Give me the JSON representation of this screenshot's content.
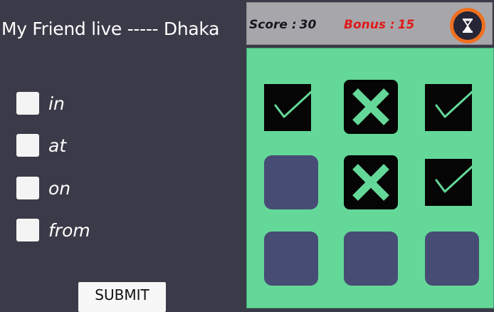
{
  "question": {
    "text": "My Friend live ----- Dhaka"
  },
  "options": [
    {
      "label": "in",
      "checked": false
    },
    {
      "label": "at",
      "checked": false
    },
    {
      "label": "on",
      "checked": false
    },
    {
      "label": "from",
      "checked": false
    }
  ],
  "submit": {
    "label": "SUBMIT"
  },
  "score": {
    "label": "Score :",
    "value": "30"
  },
  "bonus": {
    "label": "Bonus :",
    "value": "15"
  },
  "timer": {
    "icon": "hourglass-icon"
  },
  "board": {
    "cells": [
      {
        "state": "check"
      },
      {
        "state": "cross"
      },
      {
        "state": "check"
      },
      {
        "state": "empty"
      },
      {
        "state": "cross"
      },
      {
        "state": "check"
      },
      {
        "state": "empty"
      },
      {
        "state": "empty"
      },
      {
        "state": "empty"
      }
    ]
  },
  "colors": {
    "background": "#3a3a48",
    "board": "#64d898",
    "empty_cell": "#474c75",
    "mark": "#64d898",
    "bonus": "#e01a1a",
    "timer_ring": "#f07020"
  }
}
